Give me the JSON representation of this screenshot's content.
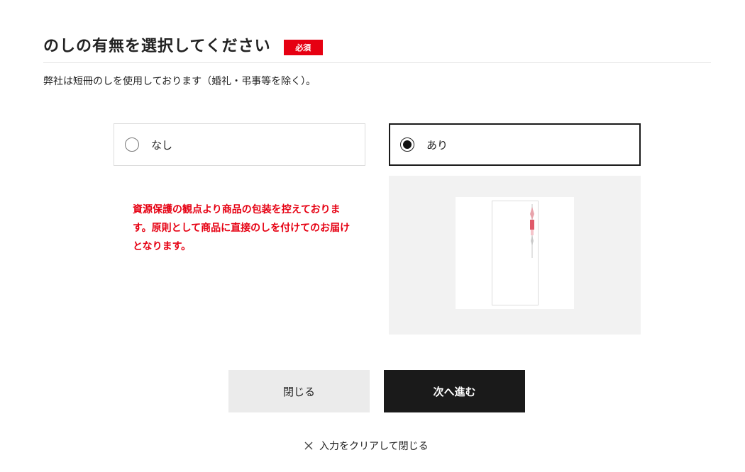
{
  "header": {
    "title": "のしの有無を選択してください",
    "required_badge": "必須"
  },
  "description": "弊社は短冊のしを使用しております（婚礼・弔事等を除く）。",
  "options": [
    {
      "label": "なし",
      "selected": false
    },
    {
      "label": "あり",
      "selected": true
    }
  ],
  "note": "資源保護の観点より商品の包装を控えております。原則として商品に直接のしを付けてのお届けとなります。",
  "buttons": {
    "close_label": "閉じる",
    "next_label": "次へ進む"
  },
  "clear_link": "入力をクリアして閉じる",
  "colors": {
    "accent_red": "#e60012",
    "primary_dark": "#1a1a1a",
    "secondary_gray": "#ebebeb",
    "preview_bg": "#f2f2f2"
  }
}
